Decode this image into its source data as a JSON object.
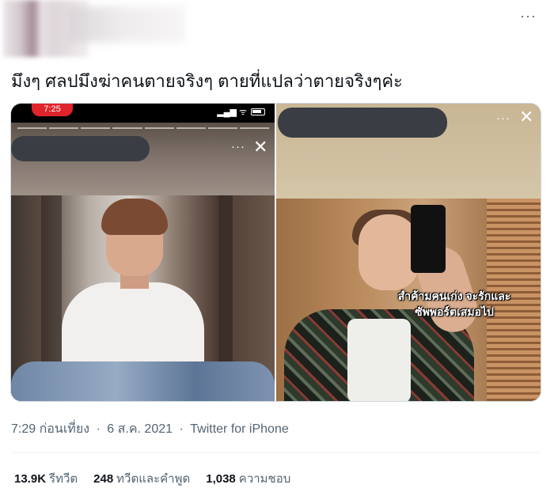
{
  "header": {
    "more_icon": "more-horizontal-icon",
    "more_label": "···"
  },
  "tweet": {
    "text": "มึงๆ ศลปมึงฆ่าคนตายจริงๆ ตายที่แปลว่าตายจริงๆค่ะ"
  },
  "media": {
    "left": {
      "status_time": "7:25",
      "status_icons": "▂▄▆ ᯤ",
      "dots": "···",
      "close": "✕"
    },
    "right": {
      "dots": "···",
      "close": "✕",
      "caption_line1": "สำค้ามคนเก่ง จะรักและ",
      "caption_line2": "ซัพพอร์ตเสมอไป"
    }
  },
  "meta": {
    "time": "7:29 ก่อนเที่ยง",
    "date": "6 ส.ค. 2021",
    "separator": "·",
    "source": "Twitter for iPhone"
  },
  "stats": [
    {
      "value": "13.9K",
      "label": "รีทวีต"
    },
    {
      "value": "248",
      "label": "ทวีตและคำพูด"
    },
    {
      "value": "1,038",
      "label": "ความชอบ"
    }
  ]
}
